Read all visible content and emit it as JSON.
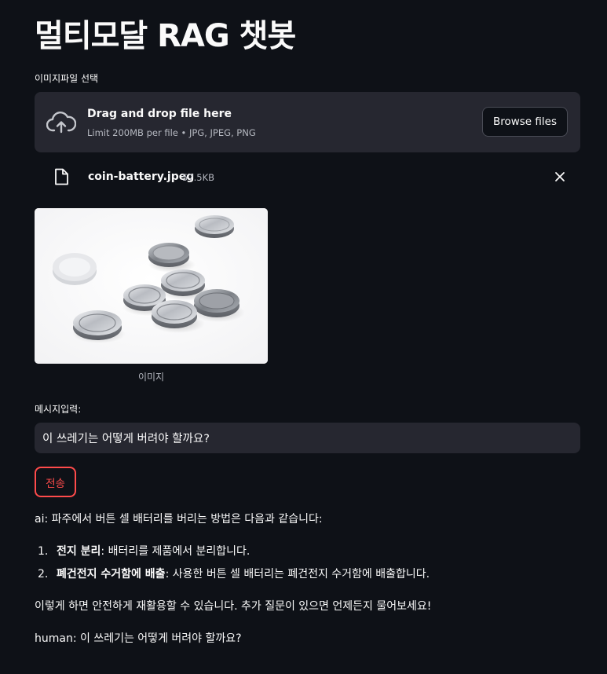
{
  "app": {
    "title": "멀티모달 RAG 챗봇"
  },
  "uploader": {
    "label": "이미지파일 선택",
    "dnd_text": "Drag and drop file here",
    "limit_text": "Limit 200MB per file • JPG, JPEG, PNG",
    "browse_label": "Browse files",
    "icon": "cloud-upload-icon"
  },
  "uploaded_file": {
    "name": "coin-battery.jpeg",
    "size": "57.5KB",
    "icon": "file-icon",
    "remove_icon": "close-icon"
  },
  "image": {
    "caption": "이미지"
  },
  "message": {
    "label": "메시지입력:",
    "value": "이 쓰레기는 어떻게 버려야 할까요?"
  },
  "send": {
    "label": "전송"
  },
  "chat": {
    "ai_intro": "ai: 파주에서 버튼 셀 배터리를 버리는 방법은 다음과 같습니다:",
    "steps": [
      {
        "num": "1.",
        "bold": "전지 분리",
        "rest": ": 배터리를 제품에서 분리합니다."
      },
      {
        "num": "2.",
        "bold": "폐건전지 수거함에 배출",
        "rest": ": 사용한 버튼 셀 배터리는 폐건전지 수거함에 배출합니다."
      }
    ],
    "ai_outro": "이렇게 하면 안전하게 재활용할 수 있습니다. 추가 질문이 있으면 언제든지 물어보세요!",
    "human": "human: 이 쓰레기는 어떻게 버려야 할까요?"
  },
  "colors": {
    "background": "#0e1117",
    "surface": "#262730",
    "accent": "#ff4b4b",
    "text": "#fafafa"
  }
}
